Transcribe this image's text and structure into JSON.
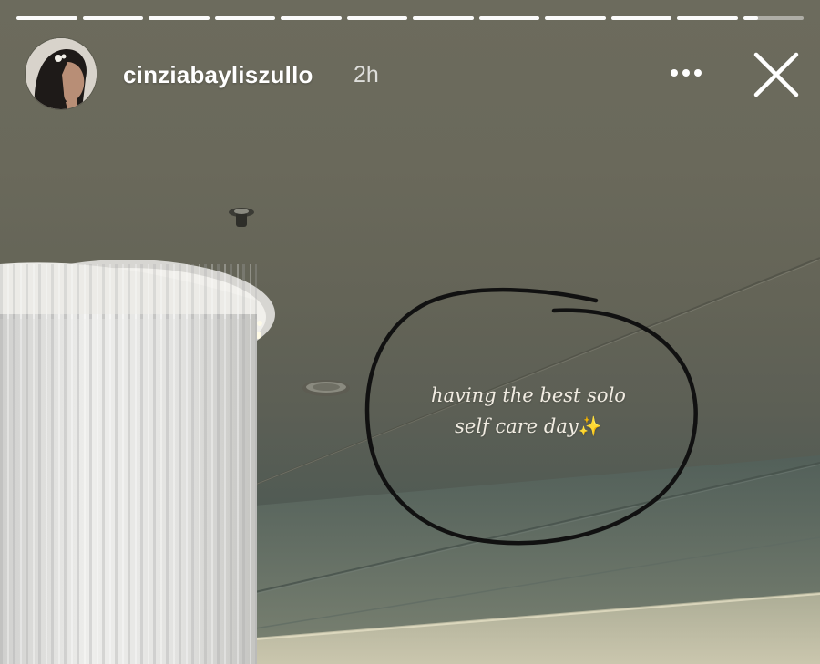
{
  "story": {
    "progress": {
      "segment_count": 12,
      "completed_segments": 11,
      "current_segment_fraction": 0.25
    },
    "header": {
      "username": "cinziabayliszullo",
      "timestamp": "2h",
      "avatar_icon": "profile-avatar-icon",
      "more_icon": "more-options-icon",
      "close_icon": "close-icon"
    },
    "caption": {
      "line1": "having the best solo",
      "line2": "self care day",
      "emoji": "✨"
    }
  }
}
